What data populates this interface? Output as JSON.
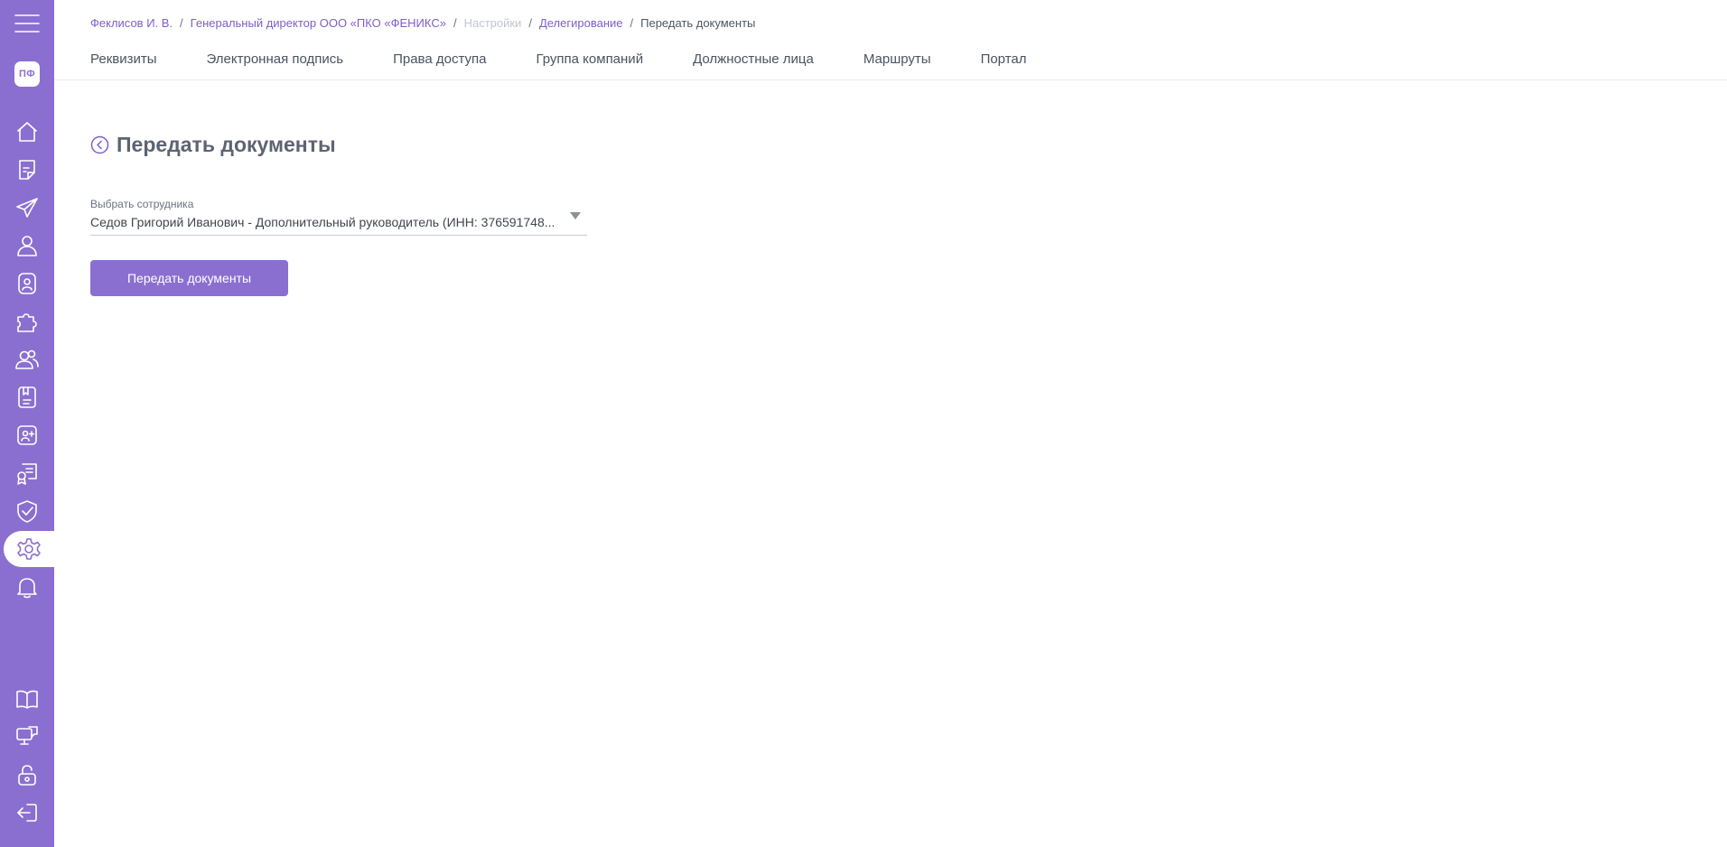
{
  "sidebar": {
    "menu_icon": "hamburger-menu-icon",
    "avatar_initials": "ПФ",
    "items": [
      {
        "icon": "home-icon"
      },
      {
        "icon": "document-icon"
      },
      {
        "icon": "send-icon"
      },
      {
        "icon": "user-icon"
      },
      {
        "icon": "id-badge-icon"
      },
      {
        "icon": "puzzle-icon"
      },
      {
        "icon": "users-group-icon"
      },
      {
        "icon": "book-list-icon"
      },
      {
        "icon": "add-contact-icon"
      },
      {
        "icon": "certificate-icon"
      },
      {
        "icon": "shield-check-icon"
      },
      {
        "icon": "gear-icon",
        "active": true
      },
      {
        "icon": "bell-icon"
      }
    ],
    "bottom_items": [
      {
        "icon": "open-book-icon"
      },
      {
        "icon": "monitor-chat-icon"
      },
      {
        "icon": "unlock-icon"
      },
      {
        "icon": "logout-icon"
      }
    ],
    "colors": {
      "background": "#8b6fd0",
      "icon": "#ffffff"
    }
  },
  "breadcrumb": {
    "items": [
      {
        "label": "Феклисов И. В."
      },
      {
        "label": "Генеральный директор ООО «ПКО «ФЕНИКС»"
      },
      {
        "label": "Настройки"
      },
      {
        "label": "Делегирование"
      },
      {
        "label": "Передать документы"
      }
    ],
    "separator": "/"
  },
  "tabs": [
    {
      "label": "Реквизиты"
    },
    {
      "label": "Электронная подпись"
    },
    {
      "label": "Права доступа"
    },
    {
      "label": "Группа компаний"
    },
    {
      "label": "Должностные лица"
    },
    {
      "label": "Маршруты"
    },
    {
      "label": "Портал"
    }
  ],
  "page": {
    "title": "Передать документы",
    "back_icon": "back-circle-icon"
  },
  "form": {
    "employee_label": "Выбрать сотрудника",
    "employee_value": "Седов Григорий Иванович - Дополнительный руководитель (ИНН: 376591748...",
    "submit_label": "Передать документы"
  },
  "colors": {
    "accent": "#8b6fd0",
    "link": "#7d5fc9",
    "text": "#4a5360"
  }
}
